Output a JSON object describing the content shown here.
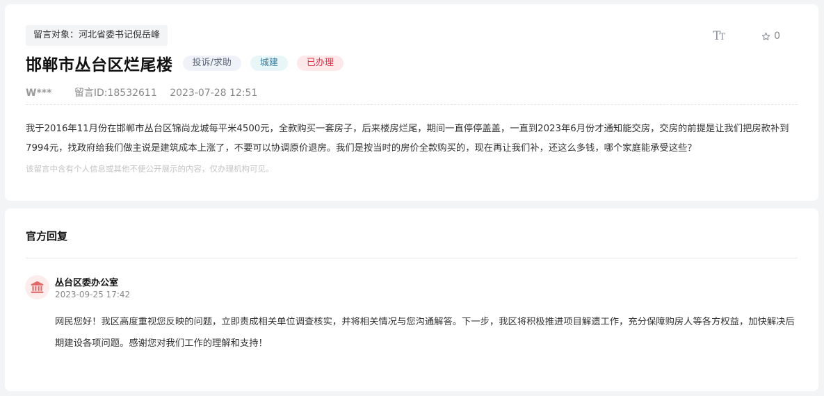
{
  "message": {
    "target_label": "留言对象：河北省委书记倪岳峰",
    "font_size_tool": "T",
    "font_size_tool_small": "T",
    "favorite_count": "0",
    "title": "邯郸市丛台区烂尾楼",
    "tags": {
      "type": "投诉/求助",
      "category": "城建",
      "status": "已办理"
    },
    "author": "W***",
    "message_id": "留言ID:18532611",
    "posted_at": "2023-07-28 12:51",
    "content": "我于2016年11月份在邯郸市丛台区锦尚龙城每平米4500元，全款购买一套房子，后来楼房烂尾，期间一直停停盖盖，一直到2023年6月份才通知能交房，交房的前提是让我们把房款补到7994元，找政府给我们做主说是建筑成本上涨了，不要可以协调原价退房。我们是按当时的房价全款购买的，现在再让我们补，还这么多钱，哪个家庭能承受这些？",
    "privacy_notice": "该留言中含有个人信息或其他不便公开展示的内容，仅办理机构可见。"
  },
  "reply": {
    "heading": "官方回复",
    "org_name": "丛台区委办公室",
    "replied_at": "2023-09-25 17:42",
    "content": "网民您好！我区高度重视您反映的问题，立即责成相关单位调查核实，并将相关情况与您沟通解答。下一步，我区将积极推进项目解遗工作，充分保障购房人等各方权益，加快解决后期建设各项问题。感谢您对我们工作的理解和支持！"
  },
  "colors": {
    "status_tag": "#e0334a",
    "category_tag": "#3c7d9c",
    "org_icon": "#e06a6a"
  },
  "icons": {
    "font_size": "font-size-icon",
    "favorite": "star-icon",
    "org": "government-building-icon"
  }
}
